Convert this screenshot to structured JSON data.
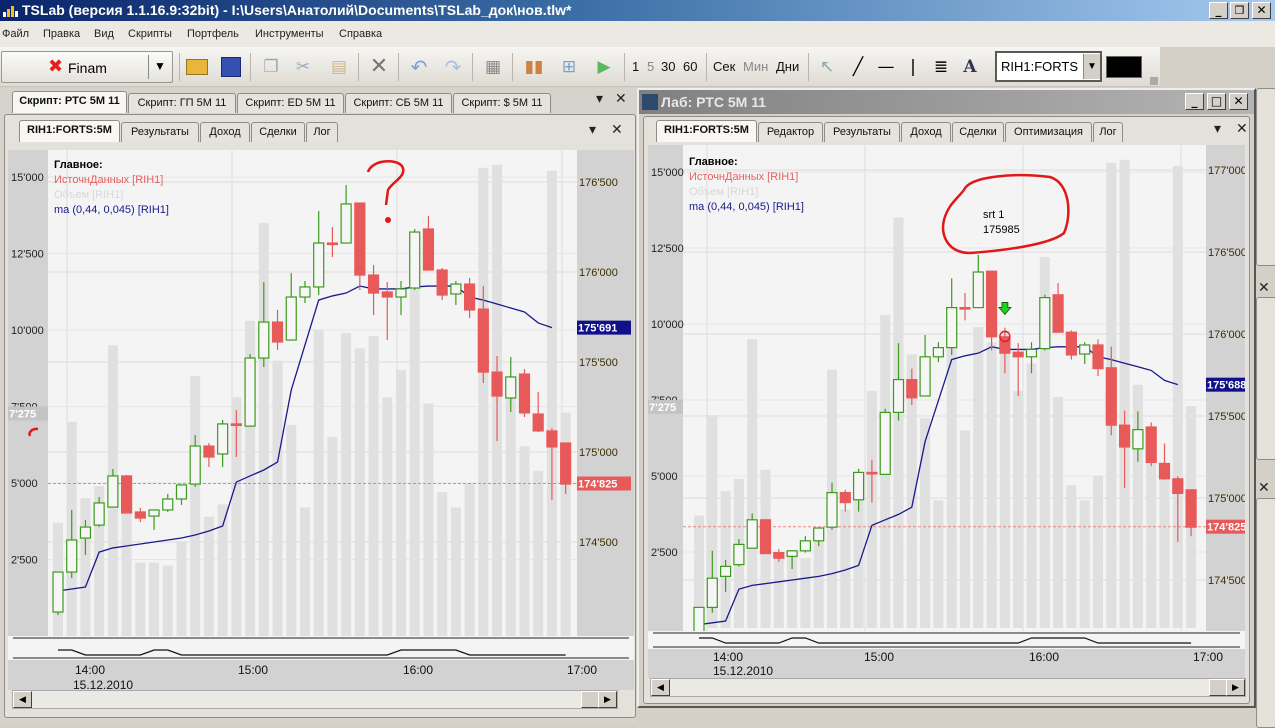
{
  "window": {
    "title": "TSLab (версия 1.1.16.9:32bit) - I:\\Users\\Анатолий\\Documents\\TSLab_док\\нов.tlw*",
    "minimize": "_",
    "restore": "❐",
    "close": "✕"
  },
  "menu": [
    "Файл",
    "Правка",
    "Вид",
    "Скрипты",
    "Портфель",
    "Инструменты",
    "Справка"
  ],
  "toolbar": {
    "provider": "Finam",
    "intervals": [
      "1",
      "5",
      "30",
      "60"
    ],
    "units": [
      "Сек",
      "Мин",
      "Дни"
    ],
    "instrument": "RIH1:FORTS",
    "color_swatch": "#000000",
    "icons": [
      "open-icon",
      "save-icon",
      "copy-icon",
      "cut-icon",
      "paste-icon",
      "delete-icon",
      "undo-icon",
      "redo-icon",
      "properties-icon",
      "chart-icon",
      "tree-icon",
      "run-icon",
      "cursor-icon",
      "line-icon",
      "hline-icon",
      "vline-icon",
      "fibonacci-icon",
      "text-icon"
    ]
  },
  "left_pane": {
    "doc_tabs": [
      "Скрипт: РТС 5М 11",
      "Скрипт: ГП 5М 11",
      "Скрипт: ED 5М 11",
      "Скрипт: СБ 5М 11",
      "Скрипт: $ 5М 11"
    ],
    "inner_tabs": [
      "RIH1:FORTS:5M",
      "Результаты",
      "Доход",
      "Сделки",
      "Лог"
    ],
    "legend": {
      "title": "Главное:",
      "source": "ИсточнДанных [RIH1]",
      "volume": "Объем [RIH1]",
      "ma": "ma (0,44, 0,045) [RIH1]"
    },
    "ma_last_label": "175'691",
    "annotation_mark": "?"
  },
  "right_pane": {
    "title": "Лаб: РТС 5М 11",
    "inner_tabs": [
      "RIH1:FORTS:5M",
      "Редактор",
      "Результаты",
      "Доход",
      "Сделки",
      "Оптимизация",
      "Лог"
    ],
    "legend": {
      "title": "Главное:",
      "source": "ИсточнДанных [RIH1]",
      "volume": "Объем [RIH1]",
      "ma": "ma (0,44, 0,045) [RIH1]"
    },
    "ma_last_label": "175'688",
    "signal": {
      "name": "srt 1",
      "price": "175985",
      "candle_index": 23,
      "price_value": 175985
    }
  },
  "colors": {
    "up": "#3d9a1c",
    "down": "#e85a5a",
    "ma": "#1a1a8c",
    "volume": "#e0e0e0",
    "last_price": "#e85a5a"
  },
  "time_axis": {
    "labels": [
      "14:00",
      "15:00",
      "16:00",
      "17:00"
    ],
    "date": "15.12.2010"
  },
  "chart_data": {
    "type": "candlestick",
    "instrument": "RIH1:FORTS",
    "timeframe": "5M",
    "last_price": 174825,
    "last_price_label": "174'825",
    "last_volume": 7275,
    "last_volume_label": "7'275",
    "left_price_ticks": [
      {
        "label": "176'500",
        "value": 176500
      },
      {
        "label": "176'000",
        "value": 176000
      },
      {
        "label": "175'500",
        "value": 175500
      },
      {
        "label": "175'000",
        "value": 175000
      },
      {
        "label": "174'500",
        "value": 174500
      }
    ],
    "right_price_ticks": [
      {
        "label": "177'000",
        "value": 177000
      },
      {
        "label": "176'500",
        "value": 176500
      },
      {
        "label": "176'000",
        "value": 176000
      },
      {
        "label": "175'500",
        "value": 175500
      },
      {
        "label": "175'000",
        "value": 175000
      },
      {
        "label": "174'500",
        "value": 174500
      }
    ],
    "volume_ticks": [
      {
        "label": "15'000",
        "value": 15000
      },
      {
        "label": "12'500",
        "value": 12500
      },
      {
        "label": "10'000",
        "value": 10000
      },
      {
        "label": "7'500",
        "value": 7500
      },
      {
        "label": "5'000",
        "value": 5000
      },
      {
        "label": "2'500",
        "value": 2500
      }
    ],
    "ohlc": [
      [
        174111,
        174333,
        174094,
        174333
      ],
      [
        174333,
        174678,
        174300,
        174511
      ],
      [
        174522,
        174622,
        174428,
        174583
      ],
      [
        174594,
        174750,
        174583,
        174717
      ],
      [
        174694,
        174906,
        174694,
        174867
      ],
      [
        174867,
        174872,
        174661,
        174661
      ],
      [
        174667,
        174689,
        174611,
        174633
      ],
      [
        174644,
        174678,
        174567,
        174678
      ],
      [
        174678,
        174767,
        174667,
        174739
      ],
      [
        174739,
        174817,
        174706,
        174817
      ],
      [
        174822,
        175094,
        174806,
        175033
      ],
      [
        175033,
        175050,
        174917,
        174972
      ],
      [
        174989,
        175178,
        174917,
        175156
      ],
      [
        175156,
        175233,
        174972,
        175150
      ],
      [
        175144,
        175544,
        175144,
        175522
      ],
      [
        175522,
        175944,
        175472,
        175722
      ],
      [
        175722,
        175789,
        175567,
        175611
      ],
      [
        175622,
        175994,
        175622,
        175861
      ],
      [
        175861,
        175950,
        175828,
        175917
      ],
      [
        175917,
        176339,
        175872,
        176161
      ],
      [
        176161,
        176250,
        176083,
        176155
      ],
      [
        176161,
        176483,
        176161,
        176378
      ],
      [
        176383,
        176383,
        175900,
        175983
      ],
      [
        175983,
        176039,
        175761,
        175883
      ],
      [
        175889,
        175944,
        175622,
        175861
      ],
      [
        175861,
        175950,
        175761,
        175906
      ],
      [
        175911,
        176239,
        175900,
        176222
      ],
      [
        176239,
        176311,
        176011,
        176011
      ],
      [
        176011,
        176022,
        175844,
        175872
      ],
      [
        175878,
        175950,
        175817,
        175933
      ],
      [
        175933,
        175967,
        175744,
        175789
      ],
      [
        175794,
        175922,
        175383,
        175444
      ],
      [
        175444,
        175533,
        175061,
        175311
      ],
      [
        175300,
        175528,
        175222,
        175417
      ],
      [
        175433,
        175461,
        175194,
        175217
      ],
      [
        175211,
        175333,
        175111,
        175117
      ],
      [
        175117,
        175133,
        174733,
        175028
      ],
      [
        175050,
        175050,
        174767,
        174822
      ]
    ],
    "volume": [
      3700,
      7000,
      4500,
      4900,
      9500,
      5200,
      2400,
      2400,
      2300,
      3100,
      8500,
      3900,
      4300,
      7800,
      10300,
      13500,
      9000,
      6900,
      4200,
      10000,
      6500,
      9900,
      9400,
      9800,
      7800,
      8700,
      12200,
      7600,
      4700,
      4200,
      5000,
      15300,
      15400,
      8000,
      6200,
      5400,
      15200,
      7300
    ],
    "ma": [
      174228,
      174239,
      174250,
      174444,
      174467,
      174478,
      174489,
      174500,
      174511,
      174522,
      174539,
      174561,
      174589,
      174833,
      174867,
      174900,
      174944,
      175344,
      175594,
      175844,
      175867,
      175883,
      175922,
      175906,
      175906,
      175906,
      175917,
      175922,
      175922,
      175922,
      175861,
      175844,
      175822,
      175800,
      175778,
      175717,
      175691,
      null
    ],
    "indicator": [
      1,
      1,
      0,
      0,
      0,
      0,
      0,
      1,
      1,
      0,
      0,
      0,
      0,
      0,
      0,
      0,
      0,
      0,
      0,
      0,
      0,
      0,
      0,
      0,
      0,
      1,
      1,
      1,
      1,
      1,
      0,
      0,
      0,
      0,
      0,
      0,
      0,
      0
    ]
  }
}
